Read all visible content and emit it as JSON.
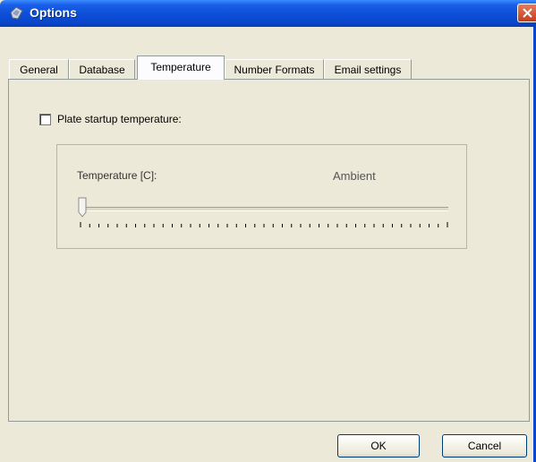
{
  "window": {
    "title": "Options"
  },
  "tabs": [
    {
      "label": "General"
    },
    {
      "label": "Database"
    },
    {
      "label": "Temperature"
    },
    {
      "label": "Number Formats"
    },
    {
      "label": "Email settings"
    }
  ],
  "active_tab": "Temperature",
  "temperature": {
    "checkbox_label": "Plate startup temperature:",
    "checkbox_checked": false,
    "slider_label": "Temperature [C]:",
    "slider_value_text": "Ambient",
    "slider_position": 0
  },
  "buttons": {
    "ok": "OK",
    "cancel": "Cancel"
  },
  "colors": {
    "titlebar": "#0a46cc",
    "close": "#c43d1c",
    "face": "#ece9d8"
  },
  "icons": {
    "title": "options-icon",
    "close": "close-icon"
  }
}
